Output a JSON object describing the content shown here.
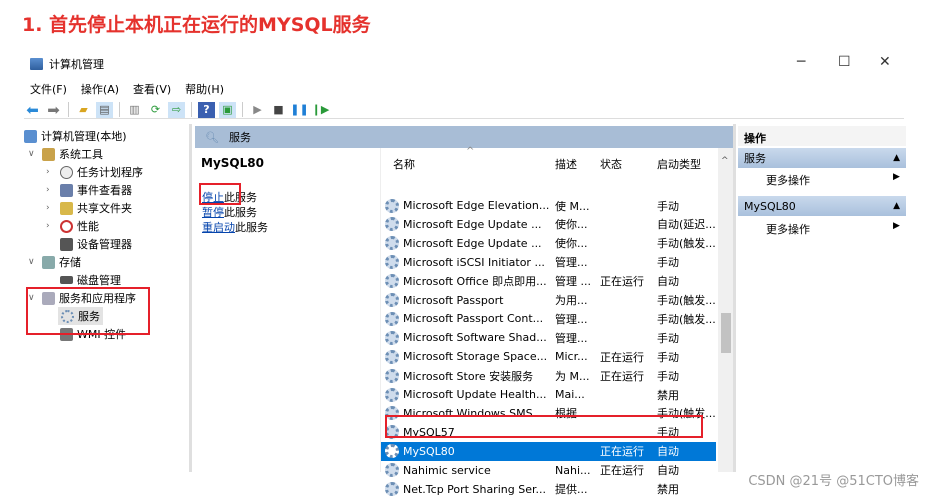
{
  "heading": "1. 首先停止本机正在运行的MYSQL服务",
  "window": {
    "title": "计算机管理",
    "minimize": "─",
    "maximize": "☐",
    "close": "✕"
  },
  "menu": [
    "文件(F)",
    "操作(A)",
    "查看(V)",
    "帮助(H)"
  ],
  "tree": {
    "root": "计算机管理(本地)",
    "system_tools": "系统工具",
    "task_scheduler": "任务计划程序",
    "event_viewer": "事件查看器",
    "shared_folders": "共享文件夹",
    "performance": "性能",
    "device_manager": "设备管理器",
    "storage": "存储",
    "disk_management": "磁盘管理",
    "services_apps": "服务和应用程序",
    "services": "服务",
    "wmi": "WMI 控件"
  },
  "middle": {
    "header": "服务",
    "selected_service": "MySQL80",
    "stop": "停止",
    "pause": "暂停",
    "restart": "重启动",
    "this_service": "此服务"
  },
  "columns": {
    "name": "名称",
    "desc": "描述",
    "status": "状态",
    "startup": "启动类型"
  },
  "services": [
    {
      "name": "Microsoft Edge Elevation...",
      "desc": "使 M...",
      "status": "",
      "startup": "手动"
    },
    {
      "name": "Microsoft Edge Update ...",
      "desc": "使你...",
      "status": "",
      "startup": "自动(延迟..."
    },
    {
      "name": "Microsoft Edge Update ...",
      "desc": "使你...",
      "status": "",
      "startup": "手动(触发..."
    },
    {
      "name": "Microsoft iSCSI Initiator ...",
      "desc": "管理...",
      "status": "",
      "startup": "手动"
    },
    {
      "name": "Microsoft Office 即点即用...",
      "desc": "管理 ...",
      "status": "正在运行",
      "startup": "自动"
    },
    {
      "name": "Microsoft Passport",
      "desc": "为用...",
      "status": "",
      "startup": "手动(触发..."
    },
    {
      "name": "Microsoft Passport Cont...",
      "desc": "管理...",
      "status": "",
      "startup": "手动(触发..."
    },
    {
      "name": "Microsoft Software Shad...",
      "desc": "管理...",
      "status": "",
      "startup": "手动"
    },
    {
      "name": "Microsoft Storage Space...",
      "desc": "Micr...",
      "status": "正在运行",
      "startup": "手动"
    },
    {
      "name": "Microsoft Store 安装服务",
      "desc": "为 M...",
      "status": "正在运行",
      "startup": "手动"
    },
    {
      "name": "Microsoft Update Health...",
      "desc": "Mai...",
      "status": "",
      "startup": "禁用"
    },
    {
      "name": "Microsoft Windows SMS ...",
      "desc": "根据...",
      "status": "",
      "startup": "手动(触发..."
    },
    {
      "name": "MySQL57",
      "desc": "",
      "status": "",
      "startup": "手动"
    },
    {
      "name": "MySQL80",
      "desc": "",
      "status": "正在运行",
      "startup": "自动",
      "selected": true
    },
    {
      "name": "Nahimic service",
      "desc": "Nahi...",
      "status": "正在运行",
      "startup": "自动"
    },
    {
      "name": "Net.Tcp Port Sharing Ser...",
      "desc": "提供...",
      "status": "",
      "startup": "禁用"
    }
  ],
  "actions": {
    "title": "操作",
    "group1": "服务",
    "group2": "MySQL80",
    "more": "更多操作"
  },
  "watermark": "CSDN @21号  @51CTO博客"
}
